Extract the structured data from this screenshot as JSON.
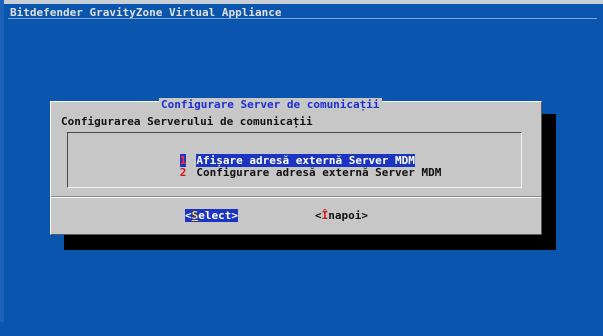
{
  "screen": {
    "backtitle": "Bitdefender GravityZone Virtual Appliance"
  },
  "dialog": {
    "title": "Configurare Server de comunicații",
    "prompt": "Configurarea Serverului de comunicații",
    "menu": [
      {
        "tag": "1",
        "label": "Afișare adresă externă Server MDM",
        "selected": true
      },
      {
        "tag": "2",
        "label": "Configurare adresă externă Server MDM",
        "selected": false
      }
    ],
    "buttons": {
      "select": {
        "open": "<",
        "hotkey": "S",
        "rest": "elect",
        "close": ">"
      },
      "back": {
        "open": "<",
        "hotkey": "Î",
        "rest": "napoi",
        "close": ">"
      }
    }
  },
  "colors": {
    "background": "#0A55AE",
    "dialog": "#C7C7C7",
    "highlight": "#1B34C2",
    "title": "#1B2FD6",
    "tag": "#D01818"
  }
}
